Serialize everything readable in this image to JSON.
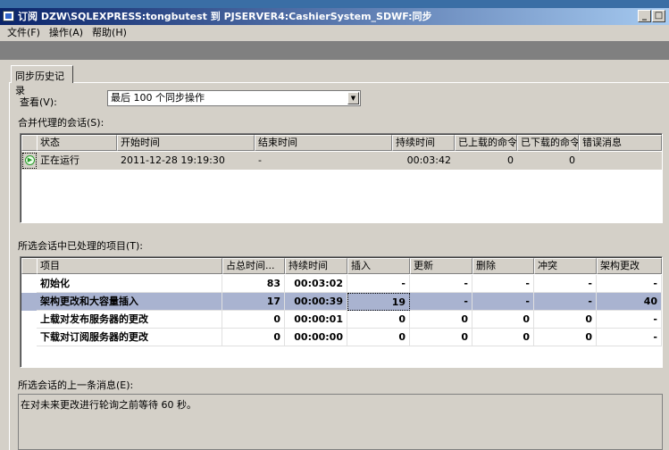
{
  "window": {
    "title": "订阅 DZW\\SQLEXPRESS:tongbutest 到 PJSERVER4:CashierSystem_SDWF:同步"
  },
  "menu": [
    "文件(F)",
    "操作(A)",
    "帮助(H)"
  ],
  "tab": "同步历史记录",
  "view": {
    "label": "查看(V):",
    "value": "最后 100 个同步操作"
  },
  "sessions": {
    "label": "合并代理的会话(S):",
    "columns": [
      "状态",
      "开始时间",
      "结束时间",
      "持续时间",
      "已上载的命令",
      "已下载的命令",
      "错误消息"
    ],
    "rows": [
      {
        "status": "正在运行",
        "start": "2011-12-28 19:19:30",
        "end": "-",
        "duration": "00:03:42",
        "uploaded": "0",
        "downloaded": "0",
        "error": ""
      }
    ]
  },
  "items": {
    "label": "所选会话中已处理的项目(T):",
    "columns": [
      "项目",
      "占总时间...",
      "持续时间",
      "插入",
      "更新",
      "删除",
      "冲突",
      "架构更改"
    ],
    "rows": [
      [
        "初始化",
        "83",
        "00:03:02",
        "-",
        "-",
        "-",
        "-",
        "-"
      ],
      [
        "架构更改和大容量插入",
        "17",
        "00:00:39",
        "19",
        "-",
        "-",
        "-",
        "40"
      ],
      [
        "上载对发布服务器的更改",
        "0",
        "00:00:01",
        "0",
        "0",
        "0",
        "0",
        "-"
      ],
      [
        "下载对订阅服务器的更改",
        "0",
        "00:00:00",
        "0",
        "0",
        "0",
        "0",
        "-"
      ]
    ],
    "selected_row": 1
  },
  "last_message": {
    "label": "所选会话的上一条消息(E):",
    "text": "在对未来更改进行轮询之前等待 60 秒。"
  },
  "colors": {
    "title_start": "#0a246a",
    "selected_row": "#a9b3d0",
    "running": "#2a9a2a"
  }
}
